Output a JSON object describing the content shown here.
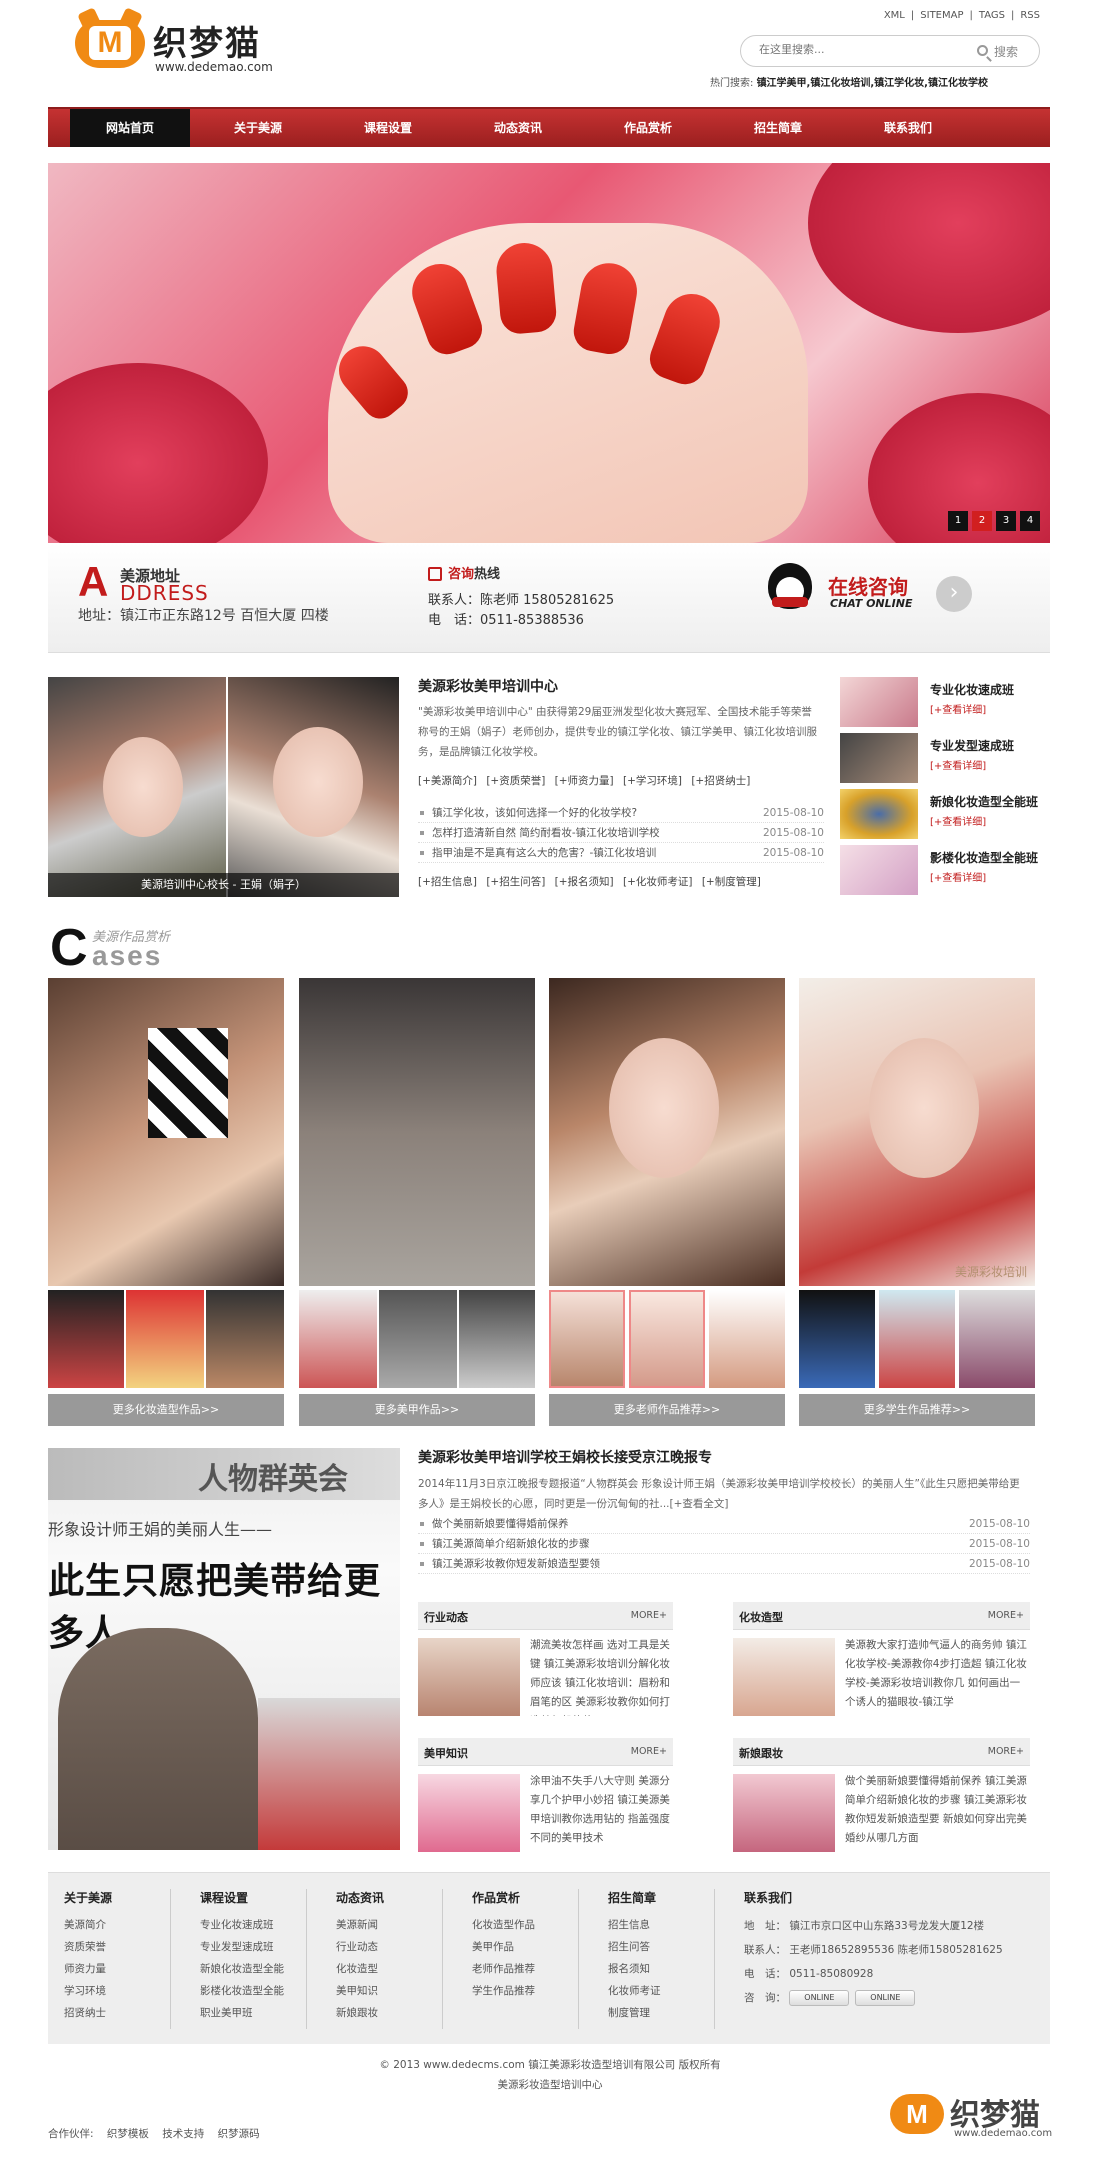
{
  "logo": {
    "letter": "M",
    "name": "织梦猫",
    "url": "www.dedemao.com"
  },
  "toplinks": [
    "XML",
    "|",
    "SITEMAP",
    "|",
    "TAGS",
    "|",
    "RSS"
  ],
  "search": {
    "placeholder": "在这里搜索...",
    "button": "搜索"
  },
  "hot": {
    "label": "热门搜索:",
    "items": "镇江学美甲,镇江化妆培训,镇江学化妆,镇江化妆学校"
  },
  "nav": [
    "网站首页",
    "关于美源",
    "课程设置",
    "动态资讯",
    "作品赏析",
    "招生简章",
    "联系我们"
  ],
  "banner": {
    "pages": [
      "1",
      "2",
      "3",
      "4"
    ],
    "active": 1
  },
  "contact": {
    "addr_letter": "A",
    "addr_title": "美源地址",
    "addr_en": "DDRESS",
    "addr_line": "地址：镇江市正东路12号 百恒大厦 四楼",
    "tel_title_red": "咨询",
    "tel_title": "热线",
    "tel_1": "联系人：陈老师 15805281625",
    "tel_2": "电　话：0511-85388536",
    "online_cn": "在线咨询",
    "online_en": "CHAT ONLINE",
    "go": "›"
  },
  "intro": {
    "caption": "美源培训中心校长 - 王娟（娟子）",
    "title": "美源彩妆美甲培训中心",
    "text": "\"美源彩妆美甲培训中心\" 由获得第29届亚洲发型化妆大赛冠军、全国技术能手等荣誉称号的王娟（娟子）老师创办，提供专业的镇江学化妆、镇江学美甲、镇江化妆培训服务，是品牌镇江化妆学校。",
    "links": "[+美源简介]  [+资质荣誉]  [+师资力量]  [+学习环境]  [+招贤纳士]",
    "news": [
      {
        "t": "镇江学化妆，该如何选择一个好的化妆学校?",
        "d": "2015-08-10"
      },
      {
        "t": "怎样打造清新自然 简约耐看妆-镇江化妆培训学校",
        "d": "2015-08-10"
      },
      {
        "t": "指甲油是不是真有这么大的危害？-镇江化妆培训",
        "d": "2015-08-10"
      }
    ],
    "links2": "[+招生信息]  [+招生问答]  [+报名须知]  [+化妆师考证]  [+制度管理]"
  },
  "courses": [
    {
      "title": "专业化妆速成班",
      "more": "[+查看详细]"
    },
    {
      "title": "专业发型速成班",
      "more": "[+查看详细]"
    },
    {
      "title": "新娘化妆造型全能班",
      "more": "[+查看详细]"
    },
    {
      "title": "影楼化妆造型全能班",
      "more": "[+查看详细]"
    }
  ],
  "cases": {
    "C": "C",
    "cn": "美源作品赏析",
    "en": "ases",
    "more": [
      "更多化妆造型作品>>",
      "更多美甲作品>>",
      "更多老师作品推荐>>",
      "更多学生作品推荐>>"
    ],
    "watermark": "美源彩妆培训"
  },
  "news2": {
    "np_art": "人物群英会",
    "np_h1": "形象设计师王娟的美丽人生——",
    "np_h2": "此生只愿把美带给更多人",
    "title": "美源彩妆美甲培训学校王娟校长接受京江晚报专",
    "text": "2014年11月3日京江晚报专题报道“人物群英会 形象设计师王娟（美源彩妆美甲培训学校校长）的美丽人生”《此生只愿把美带给更多人》是王娟校长的心愿，同时更是一份沉甸甸的社...[+查看全文]",
    "list": [
      {
        "t": "做个美丽新娘要懂得婚前保养",
        "d": "2015-08-10"
      },
      {
        "t": "镇江美源简单介绍新娘化妆的步骤",
        "d": "2015-08-10"
      },
      {
        "t": "镇江美源彩妆教你短发新娘造型要领",
        "d": "2015-08-10"
      }
    ]
  },
  "cats": [
    {
      "title": "行业动态",
      "more": "MORE+",
      "text": "潮流美妆怎样画 选对工具是关键 镇江美源彩妆培训分解化妆师应该 镇江化妆培训：眉粉和眉笔的区 美源彩妆教你如何打造梦幻般的妆"
    },
    {
      "title": "化妆造型",
      "more": "MORE+",
      "text": "美源教大家打造帅气逼人的商务帅 镇江化妆学校-美源教你4步打造超 镇江化妆学校-美源彩妆培训教你几 如何画出一个诱人的猫眼妆-镇江学"
    },
    {
      "title": "美甲知识",
      "more": "MORE+",
      "text": "涂甲油不失手八大守则 美源分享几个护甲小妙招 镇江美源美甲培训教你选用钻的 指盖强度不同的美甲技术"
    },
    {
      "title": "新娘跟妆",
      "more": "MORE+",
      "text": "做个美丽新娘要懂得婚前保养 镇江美源简单介绍新娘化妆的步骤 镇江美源彩妆教你短发新娘造型要 新娘如何穿出完美婚纱从哪几方面"
    }
  ],
  "footer": {
    "cols": [
      {
        "h": "关于美源",
        "items": [
          "美源简介",
          "资质荣誉",
          "师资力量",
          "学习环境",
          "招贤纳士"
        ]
      },
      {
        "h": "课程设置",
        "items": [
          "专业化妆速成班",
          "专业发型速成班",
          "新娘化妆造型全能",
          "影楼化妆造型全能",
          "职业美甲班"
        ]
      },
      {
        "h": "动态资讯",
        "items": [
          "美源新闻",
          "行业动态",
          "化妆造型",
          "美甲知识",
          "新娘跟妆"
        ]
      },
      {
        "h": "作品赏析",
        "items": [
          "化妆造型作品",
          "美甲作品",
          "老师作品推荐",
          "学生作品推荐"
        ]
      },
      {
        "h": "招生简章",
        "items": [
          "招生信息",
          "招生问答",
          "报名须知",
          "化妆师考证",
          "制度管理"
        ]
      }
    ],
    "contact_h": "联系我们",
    "contact": [
      "地　址：  镇江市京口区中山东路33号龙发大厦12楼",
      "联系人：  王老师18652895536 陈老师15805281625",
      "电　话：  0511-85080928",
      "咨　询："
    ],
    "qq": [
      "ONLINE",
      "ONLINE"
    ]
  },
  "copy1": "© 2013 www.dedecms.com 镇江美源彩妆造型培训有限公司 版权所有",
  "copy2": "美源彩妆造型培训中心",
  "partners": {
    "label": "合作伙伴:",
    "items": [
      "织梦模板",
      "技术支持",
      "织梦源码"
    ]
  },
  "colors": {
    "brand": "#c21c1c",
    "accent": "#f08a14"
  }
}
